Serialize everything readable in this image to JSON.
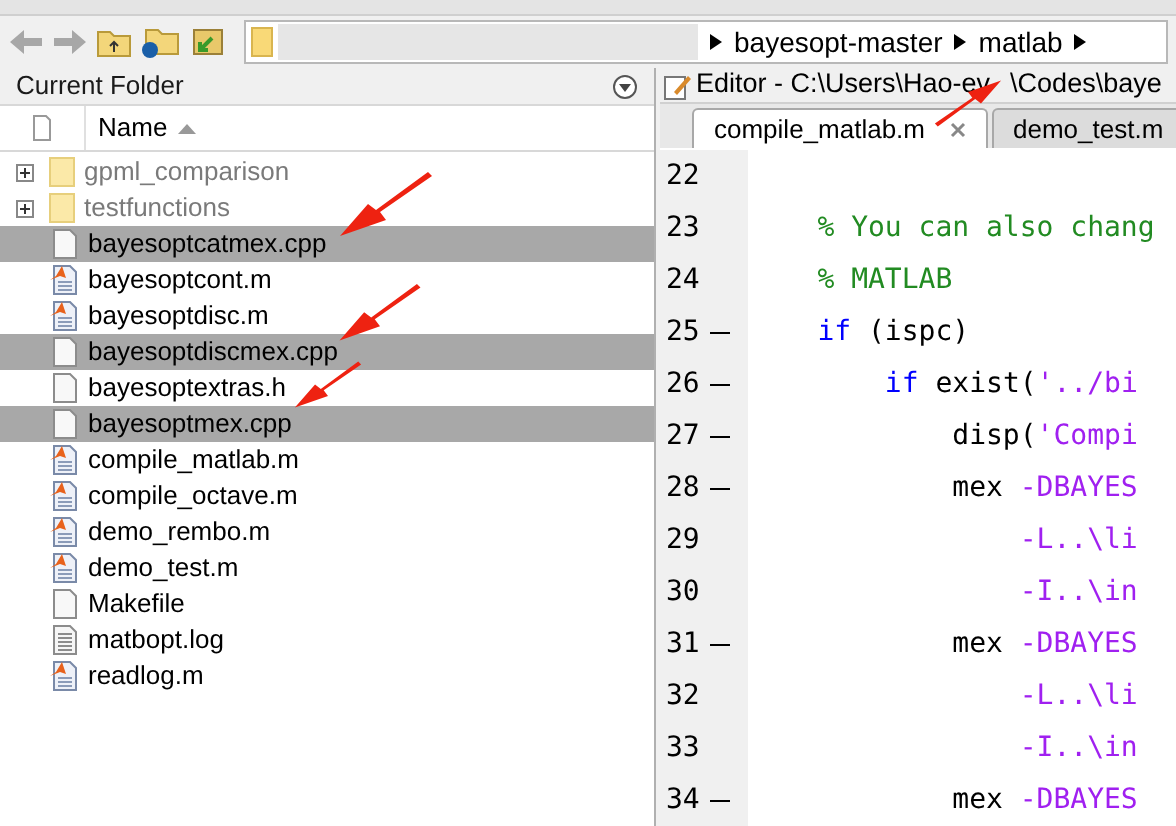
{
  "breadcrumb": [
    "bayesopt-master",
    "matlab"
  ],
  "current_folder": {
    "title": "Current Folder",
    "name_column": "Name",
    "items": [
      {
        "name": "gpml_comparison",
        "kind": "folder",
        "expanded": false,
        "selected": false
      },
      {
        "name": "testfunctions",
        "kind": "folder",
        "expanded": false,
        "selected": false
      },
      {
        "name": "bayesoptcatmex.cpp",
        "kind": "file",
        "selected": true
      },
      {
        "name": "bayesoptcont.m",
        "kind": "mfile",
        "selected": false
      },
      {
        "name": "bayesoptdisc.m",
        "kind": "mfile",
        "selected": false
      },
      {
        "name": "bayesoptdiscmex.cpp",
        "kind": "file",
        "selected": true
      },
      {
        "name": "bayesoptextras.h",
        "kind": "file",
        "selected": false
      },
      {
        "name": "bayesoptmex.cpp",
        "kind": "file",
        "selected": true
      },
      {
        "name": "compile_matlab.m",
        "kind": "mfile",
        "selected": false
      },
      {
        "name": "compile_octave.m",
        "kind": "mfile",
        "selected": false
      },
      {
        "name": "demo_rembo.m",
        "kind": "mfile",
        "selected": false
      },
      {
        "name": "demo_test.m",
        "kind": "mfile",
        "selected": false
      },
      {
        "name": "Makefile",
        "kind": "file",
        "selected": false
      },
      {
        "name": "matbopt.log",
        "kind": "log",
        "selected": false
      },
      {
        "name": "readlog.m",
        "kind": "mfile",
        "selected": false
      }
    ]
  },
  "editor": {
    "title_parts": [
      "Editor - C:\\Users\\Hao-ev",
      "\\Codes\\baye"
    ],
    "tabs": [
      {
        "label": "compile_matlab.m",
        "selected": true
      },
      {
        "label": "demo_test.m",
        "selected": false
      }
    ],
    "lines": [
      {
        "number": "22",
        "executable": false
      },
      {
        "number": "23",
        "executable": false,
        "tokens": [
          {
            "kind": "comment",
            "text": "    % You can also chang"
          }
        ]
      },
      {
        "number": "24",
        "executable": false,
        "tokens": [
          {
            "kind": "comment",
            "text": "    % MATLAB"
          }
        ]
      },
      {
        "number": "25",
        "executable": true,
        "tokens": [
          {
            "kind": "keyword",
            "text": "    if"
          },
          {
            "kind": "plain",
            "text": " (ispc)"
          }
        ]
      },
      {
        "number": "26",
        "executable": true,
        "tokens": [
          {
            "kind": "keyword",
            "text": "        if"
          },
          {
            "kind": "plain",
            "text": " exist("
          },
          {
            "kind": "string",
            "text": "'../bi"
          }
        ]
      },
      {
        "number": "27",
        "executable": true,
        "tokens": [
          {
            "kind": "plain",
            "text": "            disp("
          },
          {
            "kind": "string",
            "text": "'Compi"
          }
        ]
      },
      {
        "number": "28",
        "executable": true,
        "tokens": [
          {
            "kind": "plain",
            "text": "            mex "
          },
          {
            "kind": "string",
            "text": "-DBAYES"
          }
        ]
      },
      {
        "number": "29",
        "executable": false,
        "tokens": [
          {
            "kind": "string",
            "text": "                -L..\\li"
          }
        ]
      },
      {
        "number": "30",
        "executable": false,
        "tokens": [
          {
            "kind": "string",
            "text": "                -I..\\in"
          }
        ]
      },
      {
        "number": "31",
        "executable": true,
        "tokens": [
          {
            "kind": "plain",
            "text": "            mex "
          },
          {
            "kind": "string",
            "text": "-DBAYES"
          }
        ]
      },
      {
        "number": "32",
        "executable": false,
        "tokens": [
          {
            "kind": "string",
            "text": "                -L..\\li"
          }
        ]
      },
      {
        "number": "33",
        "executable": false,
        "tokens": [
          {
            "kind": "string",
            "text": "                -I..\\in"
          }
        ]
      },
      {
        "number": "34",
        "executable": true,
        "tokens": [
          {
            "kind": "plain",
            "text": "            mex "
          },
          {
            "kind": "string",
            "text": "-DBAYES"
          }
        ]
      }
    ]
  }
}
